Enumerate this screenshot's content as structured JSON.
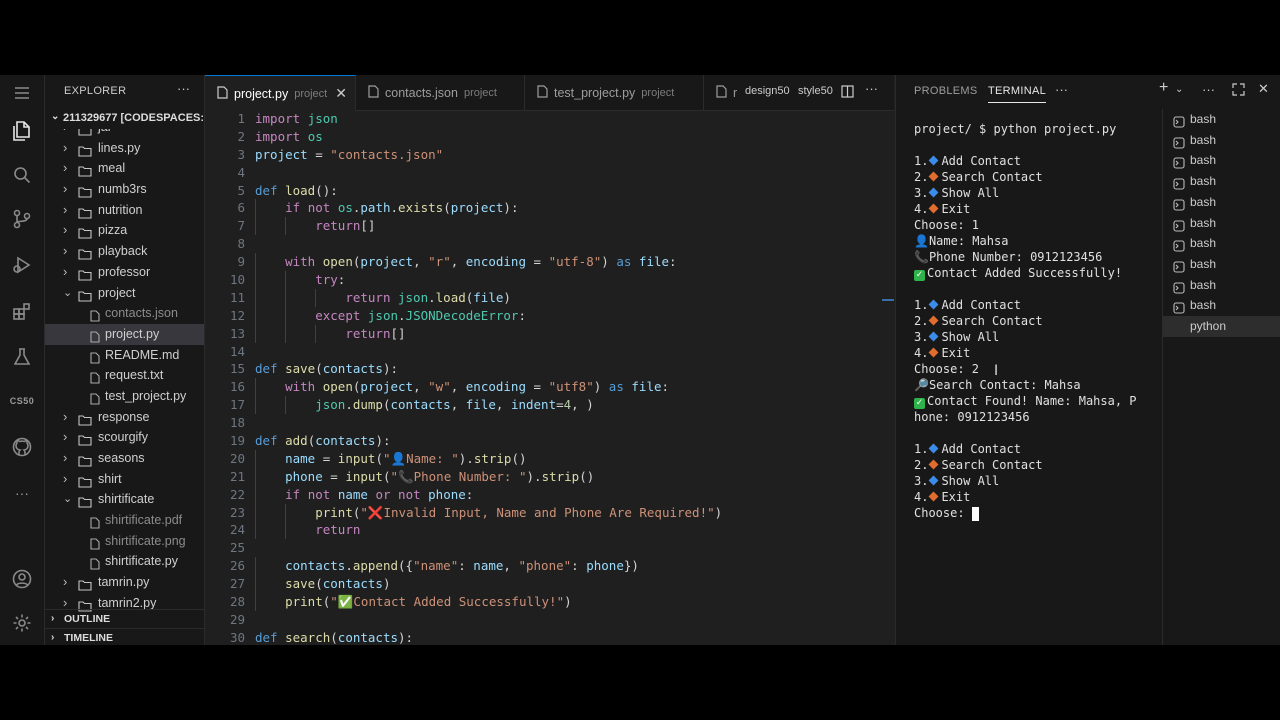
{
  "sidebar": {
    "title": "EXPLORER",
    "root": "211329677 [CODESPACES: ...",
    "tree": [
      {
        "label": "jar",
        "kind": "folder",
        "depth": 0,
        "open": false,
        "partial": true
      },
      {
        "label": "lines.py",
        "kind": "folder",
        "depth": 0,
        "open": false
      },
      {
        "label": "meal",
        "kind": "folder",
        "depth": 0,
        "open": false
      },
      {
        "label": "numb3rs",
        "kind": "folder",
        "depth": 0,
        "open": false
      },
      {
        "label": "nutrition",
        "kind": "folder",
        "depth": 0,
        "open": false
      },
      {
        "label": "pizza",
        "kind": "folder",
        "depth": 0,
        "open": false
      },
      {
        "label": "playback",
        "kind": "folder",
        "depth": 0,
        "open": false
      },
      {
        "label": "professor",
        "kind": "folder",
        "depth": 0,
        "open": false
      },
      {
        "label": "project",
        "kind": "folder",
        "depth": 0,
        "open": true
      },
      {
        "label": "contacts.json",
        "kind": "file",
        "depth": 1,
        "dim": true
      },
      {
        "label": "project.py",
        "kind": "file",
        "depth": 1,
        "selected": true
      },
      {
        "label": "README.md",
        "kind": "file",
        "depth": 1
      },
      {
        "label": "request.txt",
        "kind": "file",
        "depth": 1
      },
      {
        "label": "test_project.py",
        "kind": "file",
        "depth": 1
      },
      {
        "label": "response",
        "kind": "folder",
        "depth": 0,
        "open": false
      },
      {
        "label": "scourgify",
        "kind": "folder",
        "depth": 0,
        "open": false
      },
      {
        "label": "seasons",
        "kind": "folder",
        "depth": 0,
        "open": false
      },
      {
        "label": "shirt",
        "kind": "folder",
        "depth": 0,
        "open": false
      },
      {
        "label": "shirtificate",
        "kind": "folder",
        "depth": 0,
        "open": true
      },
      {
        "label": "shirtificate.pdf",
        "kind": "file",
        "depth": 1,
        "dim": true
      },
      {
        "label": "shirtificate.png",
        "kind": "file",
        "depth": 1,
        "dim": true
      },
      {
        "label": "shirtificate.py",
        "kind": "file",
        "depth": 1
      },
      {
        "label": "tamrin.py",
        "kind": "folder",
        "depth": 0,
        "open": false
      },
      {
        "label": "tamrin2.py",
        "kind": "folder",
        "depth": 0,
        "open": false,
        "partial": true
      }
    ],
    "outline_label": "OUTLINE",
    "timeline_label": "TIMELINE"
  },
  "activity": {
    "cs50_label": "CS50",
    "icons": [
      "menu-icon",
      "files-icon",
      "search-icon",
      "source-control-icon",
      "run-debug-icon",
      "extensions-icon",
      "testing-icon",
      "cs50-icon",
      "github-icon",
      "more-icon",
      "account-icon",
      "settings-icon"
    ]
  },
  "tabs": [
    {
      "name": "project.py",
      "desc": "project",
      "active": true
    },
    {
      "name": "contacts.json",
      "desc": "project",
      "active": false
    },
    {
      "name": "test_project.py",
      "desc": "project",
      "active": false
    },
    {
      "name": "r",
      "desc": "",
      "active": false
    }
  ],
  "tab_extra": {
    "a": "design50",
    "b": "style50"
  },
  "code_lines": [
    "import json",
    "import os",
    "project = \"contacts.json\"",
    "",
    "def load():",
    "    if not os.path.exists(project):",
    "        return[]",
    "",
    "    with open(project, \"r\", encoding = \"utf-8\") as file:",
    "        try:",
    "            return json.load(file)",
    "        except json.JSONDecodeError:",
    "            return[]",
    "",
    "def save(contacts):",
    "    with open(project, \"w\", encoding = \"utf8\") as file:",
    "        json.dump(contacts, file, indent=4, )",
    "",
    "def add(contacts):",
    "    name = input(\"👤Name: \").strip()",
    "    phone = input(\"📞Phone Number: \").strip()",
    "    if not name or not phone:",
    "        print(\"❌Invalid Input, Name and Phone Are Required!\")",
    "        return",
    "",
    "    contacts.append({\"name\": name, \"phone\": phone})",
    "    save(contacts)",
    "    print(\"✅Contact Added Successfully!\")",
    "",
    "def search(contacts):"
  ],
  "panel": {
    "tab_problems": "PROBLEMS",
    "tab_terminal": "TERMINAL",
    "more": "···"
  },
  "terminal_lines": [
    {
      "text": "project/ $ python project.py"
    },
    {
      "text": ""
    },
    {
      "text": "1.",
      "marker": "blue",
      "rest": "Add Contact"
    },
    {
      "text": "2.",
      "marker": "orange",
      "rest": "Search Contact"
    },
    {
      "text": "3.",
      "marker": "blue",
      "rest": "Show All"
    },
    {
      "text": "4.",
      "marker": "orange",
      "rest": "Exit"
    },
    {
      "text": "Choose: 1"
    },
    {
      "text": "👤Name: Mahsa"
    },
    {
      "text": "📞Phone Number: 0912123456"
    },
    {
      "text": "Contact Added Successfully!",
      "check": true
    },
    {
      "text": ""
    },
    {
      "text": "1.",
      "marker": "blue",
      "rest": "Add Contact"
    },
    {
      "text": "2.",
      "marker": "orange",
      "rest": "Search Contact"
    },
    {
      "text": "3.",
      "marker": "blue",
      "rest": "Show All"
    },
    {
      "text": "4.",
      "marker": "orange",
      "rest": "Exit"
    },
    {
      "text": "Choose: 2"
    },
    {
      "text": "🔎Search Contact: Mahsa"
    },
    {
      "text": "Contact Found! Name: Mahsa, P",
      "check": true
    },
    {
      "text": "hone: 0912123456"
    },
    {
      "text": ""
    },
    {
      "text": "1.",
      "marker": "blue",
      "rest": "Add Contact"
    },
    {
      "text": "2.",
      "marker": "orange",
      "rest": "Search Contact"
    },
    {
      "text": "3.",
      "marker": "blue",
      "rest": "Show All"
    },
    {
      "text": "4.",
      "marker": "orange",
      "rest": "Exit"
    },
    {
      "text": "Choose: ",
      "cursor": true
    }
  ],
  "terminal_list": [
    {
      "label": "bash"
    },
    {
      "label": "bash"
    },
    {
      "label": "bash"
    },
    {
      "label": "bash"
    },
    {
      "label": "bash"
    },
    {
      "label": "bash"
    },
    {
      "label": "bash"
    },
    {
      "label": "bash"
    },
    {
      "label": "bash"
    },
    {
      "label": "bash"
    },
    {
      "label": "python",
      "active": true
    }
  ],
  "colors": {
    "accent": "#0078d4",
    "marker_blue": "#3d8be8",
    "marker_orange": "#e06c2e",
    "check_green": "#2fb24a"
  }
}
